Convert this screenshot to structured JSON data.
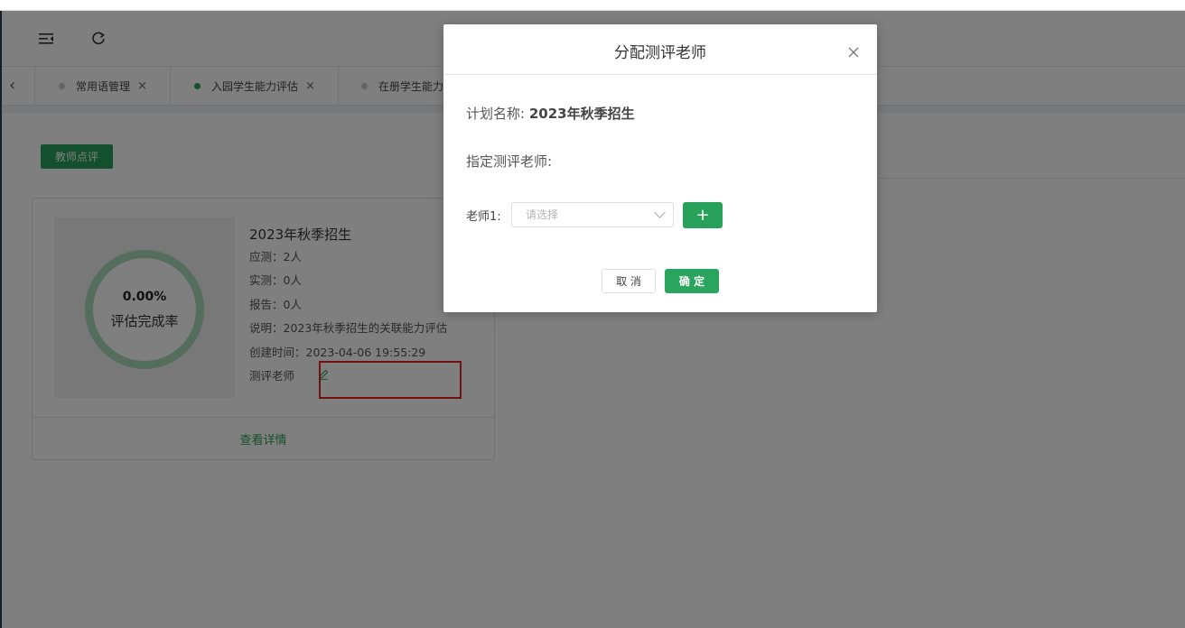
{
  "toolbar": {
    "menu_icon": "menu-fold-icon",
    "refresh_icon": "refresh-icon"
  },
  "tabs": [
    {
      "label": "常用语管理",
      "active": false
    },
    {
      "label": "入园学生能力评估",
      "active": true
    },
    {
      "label": "在册学生能力",
      "active": false
    }
  ],
  "tab_close": "×",
  "tab_back": "‹",
  "page": {
    "teacher_review_button": "教师点评",
    "card": {
      "progress_value": "0.00%",
      "progress_label": "评估完成率",
      "title": "2023年秋季招生",
      "rows": [
        "应测：2人",
        "实测：0人",
        "报告：0人",
        "说明：2023年秋季招生的关联能力评估",
        "创建时间：2023-04-06 19:55:29"
      ],
      "teacher_label": "测评老师",
      "footer_link": "查看详情"
    }
  },
  "modal": {
    "title": "分配测评老师",
    "plan_label": "计划名称:",
    "plan_name": "2023年秋季招生",
    "assign_label": "指定测评老师:",
    "teacher_field_label": "老师1:",
    "select_placeholder": "请选择",
    "add_symbol": "+",
    "cancel_label": "取 消",
    "confirm_label": "确 定"
  },
  "colors": {
    "accent": "#27a05a",
    "ring": "#a8dbb8",
    "highlight_box": "#e02020"
  }
}
